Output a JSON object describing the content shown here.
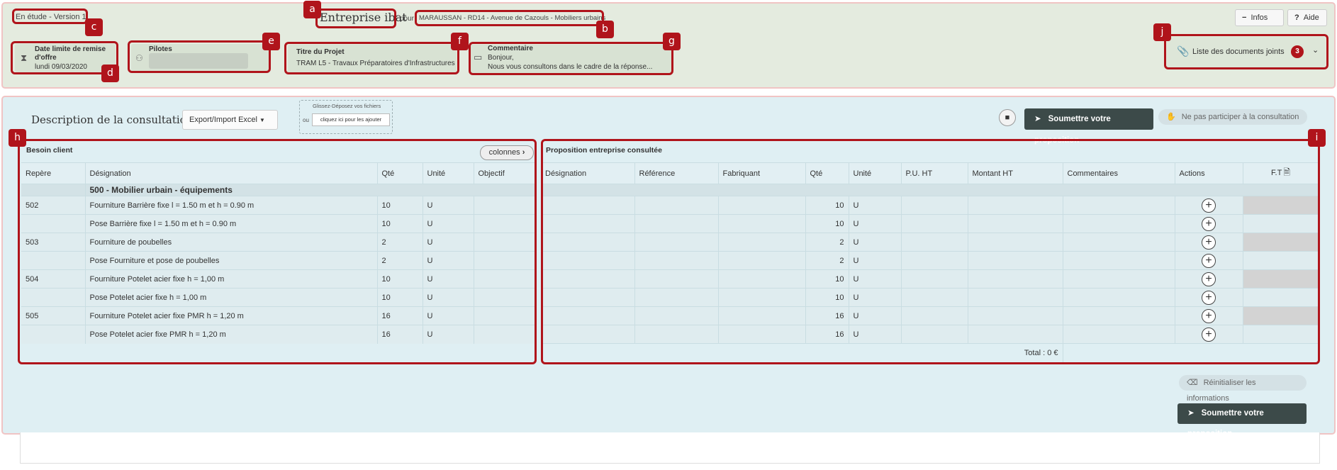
{
  "header": {
    "status": "En étude - Version 1",
    "company": "Entreprise ibat",
    "pour": "pour",
    "project_name": "MARAUSSAN - RD14 - Avenue de Cazouls - Mobiliers urbains",
    "infos_label": "Infos",
    "aide_label": "Aide",
    "date_label": "Date limite de remise d'offre",
    "date_value": "lundi 09/03/2020",
    "pilotes_label": "Pilotes",
    "titre_label": "Titre du Projet",
    "titre_value": "TRAM L5 - Travaux Préparatoires d'Infrastructures",
    "comment_label": "Commentaire",
    "comment_line1": "Bonjour,",
    "comment_line2": "Nous vous consultons dans le cadre de la réponse...",
    "docs_label": "Liste des documents joints",
    "docs_count": "3"
  },
  "annotations": {
    "a": "a",
    "b": "b",
    "c": "c",
    "d": "d",
    "e": "e",
    "f": "f",
    "g": "g",
    "h": "h",
    "i": "i",
    "j": "j"
  },
  "consultation": {
    "title": "Description de la consultation",
    "export_label": "Export/Import Excel",
    "drop_label": "Glissez-Déposez vos fichiers",
    "ou": "ou",
    "click_label": "cliquez ici pour les ajouter",
    "submit_label": "Soumettre votre proposition",
    "decline_label": "Ne pas participer à la consultation",
    "reset_label": "Réinitialiser les informations",
    "total": "Total : 0 €"
  },
  "client": {
    "title": "Besoin client",
    "columns_btn": "colonnes",
    "headers": {
      "repere": "Repère",
      "designation": "Désignation",
      "qte": "Qté",
      "unite": "Unité",
      "objectif": "Objectif"
    },
    "section": "500 - Mobilier urbain - équipements",
    "rows": [
      {
        "repere": "502",
        "designation": "Fourniture Barrière fixe l = 1.50 m et h = 0.90 m",
        "qte": "10",
        "unite": "U",
        "objectif": ""
      },
      {
        "repere": "",
        "designation": "Pose Barrière fixe l = 1.50 m et h = 0.90 m",
        "qte": "10",
        "unite": "U",
        "objectif": ""
      },
      {
        "repere": "503",
        "designation": "Fourniture de poubelles",
        "qte": "2",
        "unite": "U",
        "objectif": ""
      },
      {
        "repere": "",
        "designation": "Pose Fourniture et pose de poubelles",
        "qte": "2",
        "unite": "U",
        "objectif": ""
      },
      {
        "repere": "504",
        "designation": "Fourniture Potelet acier fixe h = 1,00 m",
        "qte": "10",
        "unite": "U",
        "objectif": ""
      },
      {
        "repere": "",
        "designation": "Pose Potelet acier fixe h = 1,00 m",
        "qte": "10",
        "unite": "U",
        "objectif": ""
      },
      {
        "repere": "505",
        "designation": "Fourniture Potelet acier fixe PMR h = 1,20 m",
        "qte": "16",
        "unite": "U",
        "objectif": ""
      },
      {
        "repere": "",
        "designation": "Pose Potelet acier fixe PMR h = 1,20 m",
        "qte": "16",
        "unite": "U",
        "objectif": ""
      }
    ]
  },
  "proposal": {
    "title": "Proposition entreprise consultée",
    "headers": {
      "designation": "Désignation",
      "reference": "Référence",
      "fabriquant": "Fabriquant",
      "qte": "Qté",
      "unite": "Unité",
      "pu": "P.U. HT",
      "montant": "Montant HT",
      "commentaires": "Commentaires",
      "actions": "Actions",
      "ft": "F.T"
    },
    "rows": [
      {
        "qte": "10",
        "unite": "U",
        "ft_grey": true
      },
      {
        "qte": "10",
        "unite": "U",
        "ft_grey": false
      },
      {
        "qte": "2",
        "unite": "U",
        "ft_grey": true
      },
      {
        "qte": "2",
        "unite": "U",
        "ft_grey": false
      },
      {
        "qte": "10",
        "unite": "U",
        "ft_grey": true
      },
      {
        "qte": "10",
        "unite": "U",
        "ft_grey": false
      },
      {
        "qte": "16",
        "unite": "U",
        "ft_grey": true
      },
      {
        "qte": "16",
        "unite": "U",
        "ft_grey": false
      }
    ],
    "plus_symbol": "+"
  },
  "colors": {
    "accent_red": "#b0141b",
    "dark_button": "#3c4a49",
    "header_bg": "#e4ebdf",
    "main_bg": "#dfeff3"
  }
}
